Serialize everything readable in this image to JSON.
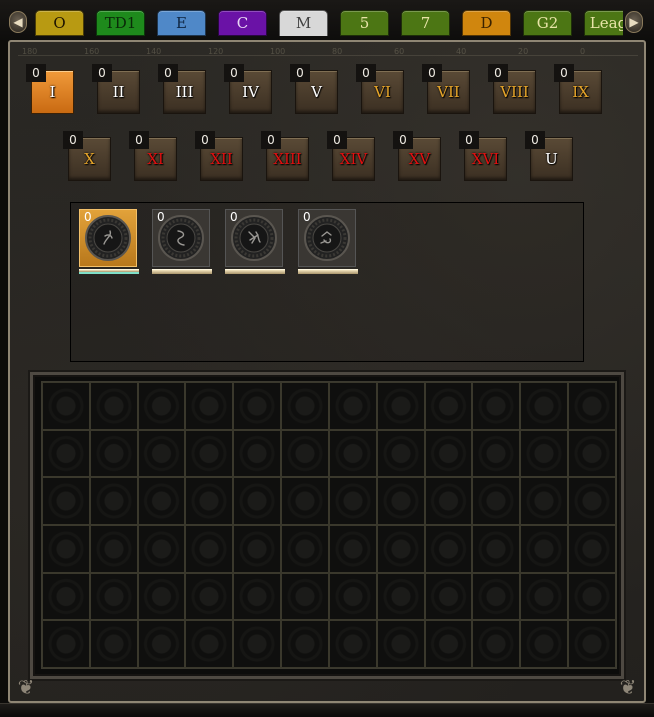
{
  "tabs": [
    {
      "label": "O",
      "bg": "#b89a12",
      "color": "#1e1400"
    },
    {
      "label": "TD1",
      "bg": "#1e8a1c",
      "color": "#0a2a08"
    },
    {
      "label": "E",
      "bg": "#4f88c8",
      "color": "#0e2440"
    },
    {
      "label": "C",
      "bg": "#6a12a6",
      "color": "#e8d6f4"
    },
    {
      "label": "M",
      "bg": "#d8d8d8",
      "color": "#404040"
    },
    {
      "label": "5",
      "bg": "#4c7614",
      "color": "#e8e4a8"
    },
    {
      "label": "7",
      "bg": "#4c7614",
      "color": "#e8e4a8"
    },
    {
      "label": "D",
      "bg": "#d0860e",
      "color": "#3a2200"
    },
    {
      "label": "G2",
      "bg": "#4c7614",
      "color": "#e8e4a8"
    },
    {
      "label": "Leag",
      "bg": "#4c7614",
      "color": "#e8e4a8"
    }
  ],
  "selected_tab": "M",
  "ruler_numbers": [
    "180",
    "160",
    "140",
    "120",
    "100",
    "80",
    "60",
    "40",
    "20",
    "0"
  ],
  "tiers_row1": [
    {
      "label": "I",
      "count": "0",
      "color": "#ffffff",
      "selected": true
    },
    {
      "label": "II",
      "count": "0",
      "color": "#ffffff"
    },
    {
      "label": "III",
      "count": "0",
      "color": "#ffffff"
    },
    {
      "label": "IV",
      "count": "0",
      "color": "#ffffff"
    },
    {
      "label": "V",
      "count": "0",
      "color": "#ffffff"
    },
    {
      "label": "VI",
      "count": "0",
      "color": "#e6a52a"
    },
    {
      "label": "VII",
      "count": "0",
      "color": "#e6a52a"
    },
    {
      "label": "VIII",
      "count": "0",
      "color": "#e6a52a"
    },
    {
      "label": "IX",
      "count": "0",
      "color": "#e6a52a"
    }
  ],
  "tiers_row2": [
    {
      "label": "X",
      "count": "0",
      "color": "#e6a52a"
    },
    {
      "label": "XI",
      "count": "0",
      "color": "#e01010"
    },
    {
      "label": "XII",
      "count": "0",
      "color": "#e01010"
    },
    {
      "label": "XIII",
      "count": "0",
      "color": "#e01010"
    },
    {
      "label": "XIV",
      "count": "0",
      "color": "#e01010"
    },
    {
      "label": "XV",
      "count": "0",
      "color": "#e01010"
    },
    {
      "label": "XVI",
      "count": "0",
      "color": "#e01010"
    },
    {
      "label": "U",
      "count": "0",
      "color": "#ffffff"
    }
  ],
  "fragments": [
    {
      "icon": "rune-fragment-1-icon",
      "count": "0",
      "selected": true
    },
    {
      "icon": "rune-fragment-2-icon",
      "count": "0"
    },
    {
      "icon": "rune-fragment-3-icon",
      "count": "0"
    },
    {
      "icon": "rune-fragment-4-icon",
      "count": "0"
    }
  ],
  "grid": {
    "cols": 12,
    "rows": 6
  },
  "icons": {
    "left": "◀",
    "right": "▶",
    "corner": "❦"
  }
}
